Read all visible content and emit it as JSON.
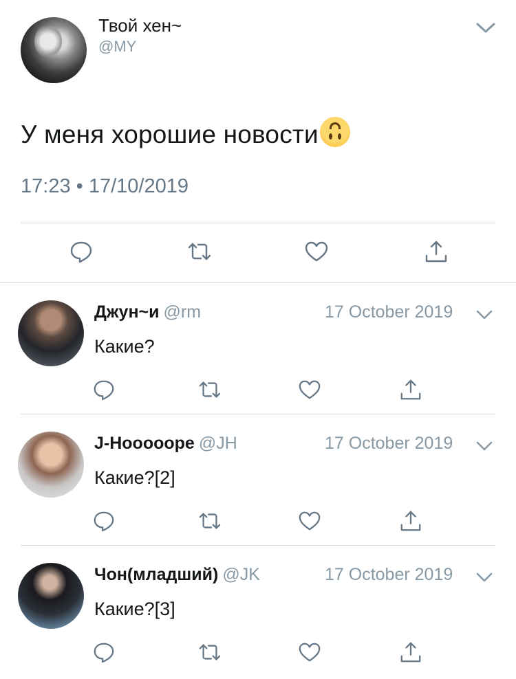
{
  "main_tweet": {
    "name": "Твой хен~",
    "handle": "@MY",
    "text": "У меня хорошие новости",
    "emoji": "upside-down-face",
    "time": "17:23 • 17/10/2019",
    "actions": [
      "reply-icon",
      "retweet-icon",
      "like-icon",
      "share-icon"
    ]
  },
  "replies": [
    {
      "name": "Джун~и",
      "handle": "@rm",
      "date": "17 October 2019",
      "text": "Какие?"
    },
    {
      "name": "J-Hooooope",
      "handle": "@JH",
      "date": "17 October 2019",
      "text": "Какие?[2]"
    },
    {
      "name": "Чон(младший)",
      "handle": "@JK",
      "date": "17 October 2019",
      "text": "Какие?[3]"
    }
  ],
  "colors": {
    "text": "#14171a",
    "secondary": "#8899a6",
    "icon": "#657786",
    "divider": "#d5dbe0"
  }
}
